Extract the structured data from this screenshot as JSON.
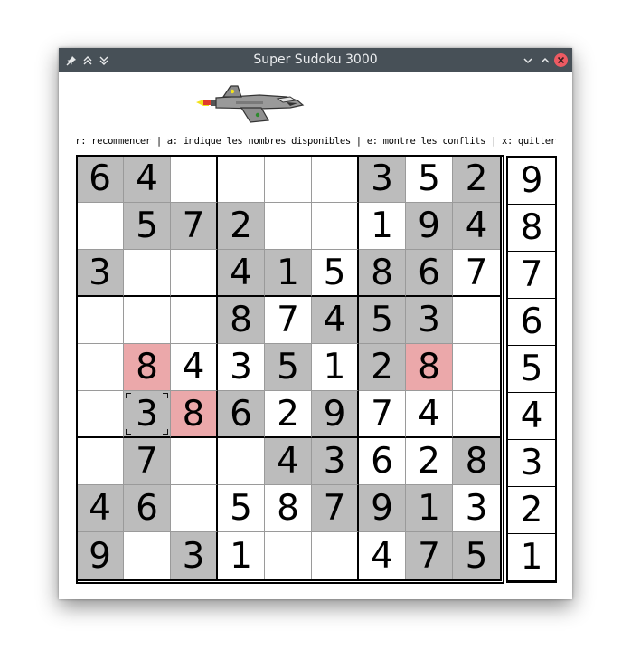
{
  "window": {
    "title": "Super Sudoku 3000",
    "titlebar_color": "#475057",
    "close_color": "#ed5a62"
  },
  "help_text": "r: recommencer | a: indique les nombres disponibles | e: montre les conflits | x: quitter",
  "board": {
    "rows": [
      [
        {
          "v": "6",
          "bg": "grey"
        },
        {
          "v": "4",
          "bg": "grey"
        },
        {
          "v": "",
          "bg": "white"
        },
        {
          "v": "",
          "bg": "white"
        },
        {
          "v": "",
          "bg": "white"
        },
        {
          "v": "",
          "bg": "white"
        },
        {
          "v": "3",
          "bg": "grey"
        },
        {
          "v": "5",
          "bg": "white"
        },
        {
          "v": "2",
          "bg": "grey"
        }
      ],
      [
        {
          "v": "",
          "bg": "white"
        },
        {
          "v": "5",
          "bg": "grey"
        },
        {
          "v": "7",
          "bg": "grey"
        },
        {
          "v": "2",
          "bg": "grey"
        },
        {
          "v": "",
          "bg": "white"
        },
        {
          "v": "",
          "bg": "white"
        },
        {
          "v": "1",
          "bg": "white"
        },
        {
          "v": "9",
          "bg": "grey"
        },
        {
          "v": "4",
          "bg": "grey"
        }
      ],
      [
        {
          "v": "3",
          "bg": "grey"
        },
        {
          "v": "",
          "bg": "white"
        },
        {
          "v": "",
          "bg": "white"
        },
        {
          "v": "4",
          "bg": "grey"
        },
        {
          "v": "1",
          "bg": "grey"
        },
        {
          "v": "5",
          "bg": "white"
        },
        {
          "v": "8",
          "bg": "grey"
        },
        {
          "v": "6",
          "bg": "grey"
        },
        {
          "v": "7",
          "bg": "white"
        }
      ],
      [
        {
          "v": "",
          "bg": "white"
        },
        {
          "v": "",
          "bg": "white"
        },
        {
          "v": "",
          "bg": "white"
        },
        {
          "v": "8",
          "bg": "grey"
        },
        {
          "v": "7",
          "bg": "white"
        },
        {
          "v": "4",
          "bg": "grey"
        },
        {
          "v": "5",
          "bg": "grey"
        },
        {
          "v": "3",
          "bg": "grey"
        },
        {
          "v": "",
          "bg": "white"
        }
      ],
      [
        {
          "v": "",
          "bg": "white"
        },
        {
          "v": "8",
          "bg": "pink"
        },
        {
          "v": "4",
          "bg": "white"
        },
        {
          "v": "3",
          "bg": "white"
        },
        {
          "v": "5",
          "bg": "grey"
        },
        {
          "v": "1",
          "bg": "white"
        },
        {
          "v": "2",
          "bg": "grey"
        },
        {
          "v": "8",
          "bg": "pink"
        },
        {
          "v": "",
          "bg": "white"
        }
      ],
      [
        {
          "v": "",
          "bg": "white"
        },
        {
          "v": "3",
          "bg": "grey",
          "cursor": true
        },
        {
          "v": "8",
          "bg": "pink"
        },
        {
          "v": "6",
          "bg": "grey"
        },
        {
          "v": "2",
          "bg": "white"
        },
        {
          "v": "9",
          "bg": "grey"
        },
        {
          "v": "7",
          "bg": "white"
        },
        {
          "v": "4",
          "bg": "white"
        },
        {
          "v": "",
          "bg": "white"
        }
      ],
      [
        {
          "v": "",
          "bg": "white"
        },
        {
          "v": "7",
          "bg": "grey"
        },
        {
          "v": "",
          "bg": "white"
        },
        {
          "v": "",
          "bg": "white"
        },
        {
          "v": "4",
          "bg": "grey"
        },
        {
          "v": "3",
          "bg": "grey"
        },
        {
          "v": "6",
          "bg": "white"
        },
        {
          "v": "2",
          "bg": "white"
        },
        {
          "v": "8",
          "bg": "grey"
        }
      ],
      [
        {
          "v": "4",
          "bg": "grey"
        },
        {
          "v": "6",
          "bg": "grey"
        },
        {
          "v": "",
          "bg": "white"
        },
        {
          "v": "5",
          "bg": "white"
        },
        {
          "v": "8",
          "bg": "white"
        },
        {
          "v": "7",
          "bg": "grey"
        },
        {
          "v": "9",
          "bg": "grey"
        },
        {
          "v": "1",
          "bg": "grey"
        },
        {
          "v": "3",
          "bg": "white"
        }
      ],
      [
        {
          "v": "9",
          "bg": "grey"
        },
        {
          "v": "",
          "bg": "white"
        },
        {
          "v": "3",
          "bg": "grey"
        },
        {
          "v": "1",
          "bg": "white"
        },
        {
          "v": "",
          "bg": "white"
        },
        {
          "v": "",
          "bg": "white"
        },
        {
          "v": "4",
          "bg": "white"
        },
        {
          "v": "7",
          "bg": "grey"
        },
        {
          "v": "5",
          "bg": "grey"
        }
      ]
    ]
  },
  "counts": [
    "9",
    "8",
    "7",
    "6",
    "5",
    "4",
    "3",
    "2",
    "1"
  ],
  "colors": {
    "grey": "#bcbcbc",
    "white": "#ffffff",
    "pink": "#eba8aa"
  },
  "icons": {
    "pin": "pin-icon",
    "shade_up": "keep-above-icon",
    "shade_down": "keep-below-icon",
    "minimize": "minimize-icon",
    "maximize": "maximize-icon",
    "close": "close-icon",
    "plane": "fighter-jet-icon"
  }
}
